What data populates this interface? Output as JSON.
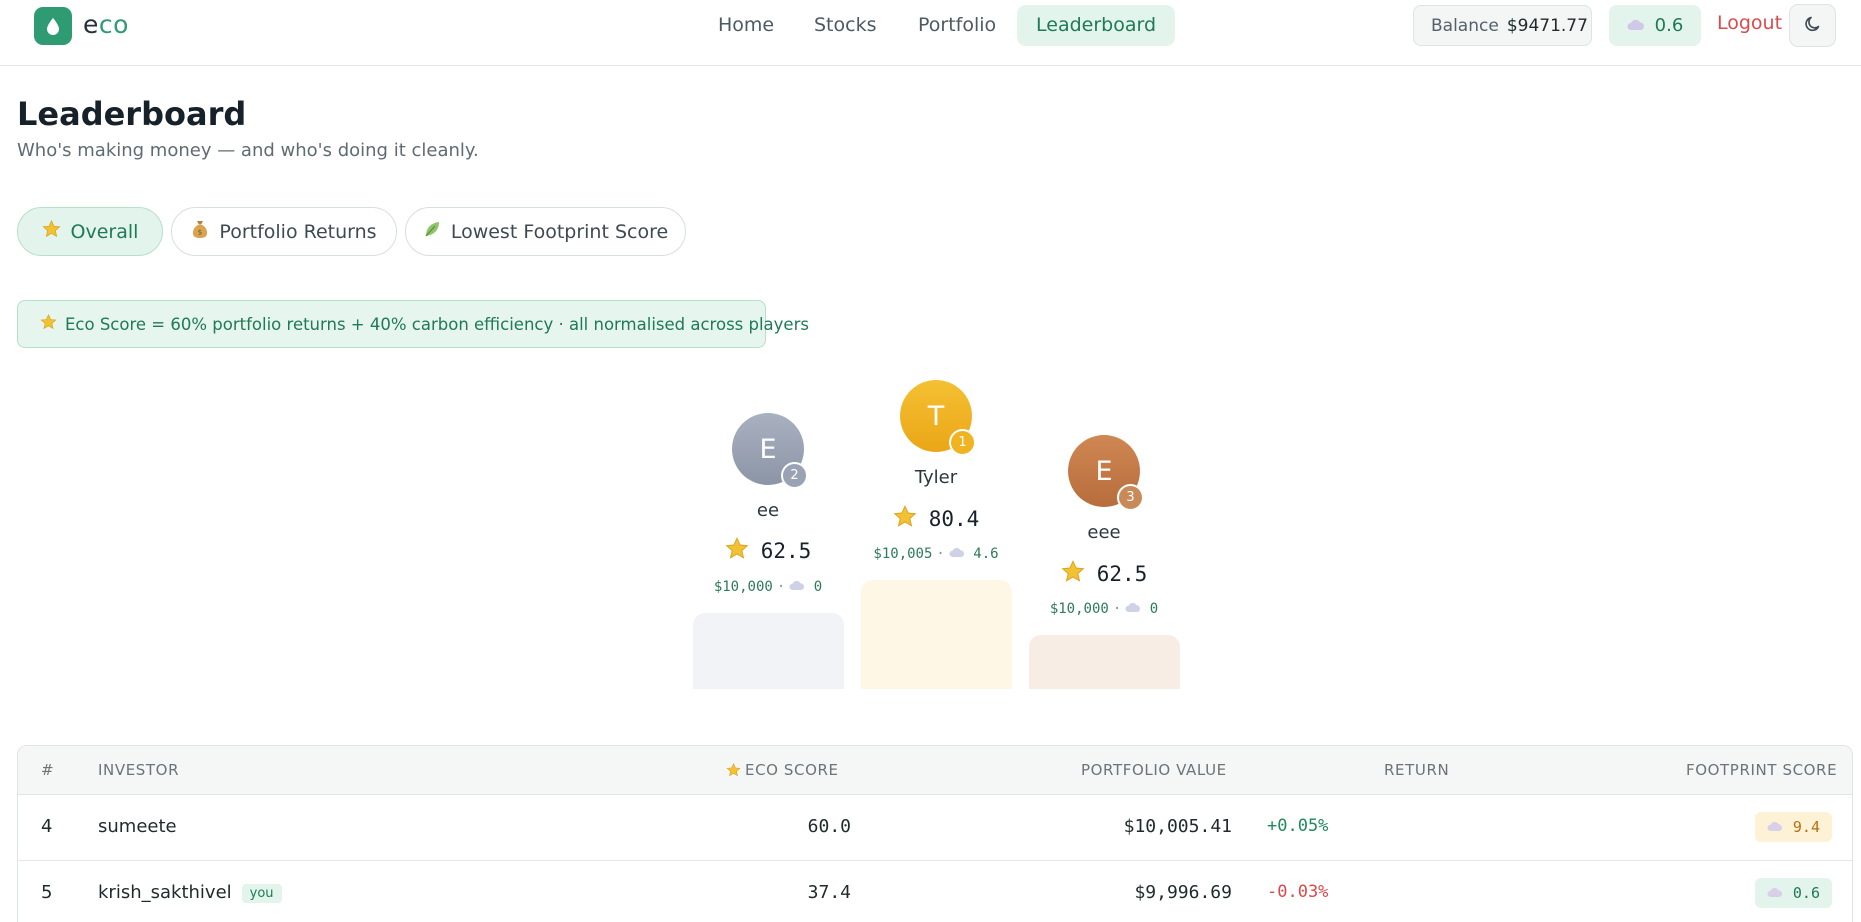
{
  "app": {
    "logo_text_a": "e",
    "logo_text_b": "co"
  },
  "nav": {
    "items": [
      {
        "label": "Home"
      },
      {
        "label": "Stocks"
      },
      {
        "label": "Portfolio"
      },
      {
        "label": "Leaderboard",
        "active": true
      }
    ],
    "balance_label": "Balance",
    "balance_value": "$9471.77",
    "footprint_value": "0.6",
    "logout_label": "Logout"
  },
  "page": {
    "title": "Leaderboard",
    "subtitle": "Who's making money — and who's doing it cleanly."
  },
  "tabs": [
    {
      "label": "Overall",
      "icon": "star-icon",
      "active": true
    },
    {
      "label": "Portfolio Returns",
      "icon": "money-bag-icon",
      "active": false
    },
    {
      "label": "Lowest Footprint Score",
      "icon": "leaf-icon",
      "active": false
    }
  ],
  "banner": {
    "text": "Eco Score = 60% portfolio returns + 40% carbon efficiency · all normalised across players"
  },
  "podium": [
    {
      "rank": "1",
      "initial": "T",
      "name": "Tyler",
      "score": "80.4",
      "value": "$10,005",
      "footprint": "4.6",
      "color": "#f0b321"
    },
    {
      "rank": "2",
      "initial": "E",
      "name": "ee",
      "score": "62.5",
      "value": "$10,000",
      "footprint": "0",
      "color": "#9aa3b4"
    },
    {
      "rank": "3",
      "initial": "E",
      "name": "eee",
      "score": "62.5",
      "value": "$10,000",
      "footprint": "0",
      "color": "#c47a47"
    }
  ],
  "table": {
    "headers": {
      "rank": "#",
      "investor": "INVESTOR",
      "eco_score": "ECO SCORE",
      "portfolio_value": "PORTFOLIO VALUE",
      "return": "RETURN",
      "footprint": "FOOTPRINT SCORE"
    },
    "rows": [
      {
        "rank": "4",
        "investor": "sumeete",
        "you": "",
        "eco_score": "60.0",
        "portfolio_value": "$10,005.41",
        "return": "+0.05%",
        "footprint": "9.4"
      },
      {
        "rank": "5",
        "investor": "krish_sakthivel",
        "you": "you",
        "eco_score": "37.4",
        "portfolio_value": "$9,996.69",
        "return": "-0.03%",
        "footprint": "0.6"
      }
    ]
  },
  "colors": {
    "brand": "#2e9b72",
    "gold": "#f0b321",
    "silver": "#9aa3b4",
    "bronze": "#c47a47",
    "positive": "#1f8a5a",
    "negative": "#d94b4b",
    "footprint_high_bg": "#fdf1d6",
    "footprint_low_bg": "#e2f4ec"
  }
}
